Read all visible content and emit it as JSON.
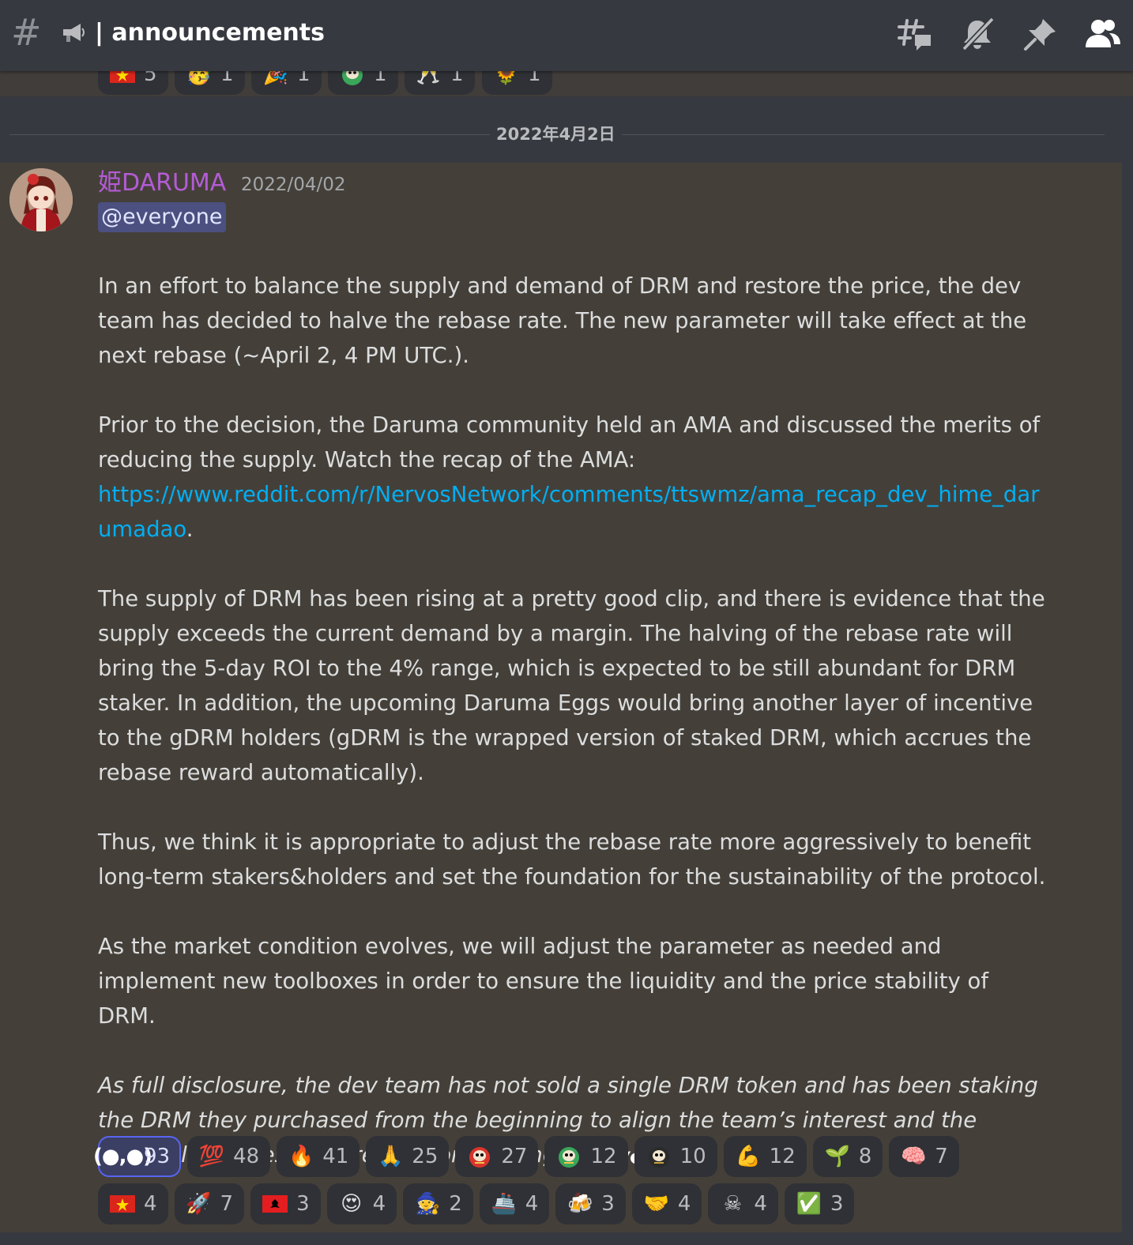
{
  "header": {
    "hash_symbol": "#",
    "channel_name": "| announcements",
    "icons": [
      "threads-icon",
      "mute-icon",
      "pin-icon",
      "members-icon"
    ]
  },
  "previous_reactions": [
    {
      "emoji": "vietnam-flag",
      "count": "5"
    },
    {
      "emoji": "party-face",
      "count": "1"
    },
    {
      "emoji": "party-popper",
      "count": "1"
    },
    {
      "emoji": "green-daruma",
      "count": "1"
    },
    {
      "emoji": "clinking-glasses",
      "count": "1"
    },
    {
      "emoji": "sunflower",
      "count": "1"
    }
  ],
  "date_divider": "2022年4月2日",
  "message": {
    "author": "姫DARUMA",
    "timestamp": "2022/04/02",
    "mention": "@everyone",
    "paragraphs": [
      "In an effort to balance the supply and demand of DRM and restore the price, the dev team has decided to halve the rebase rate. The new parameter will take effect at the next rebase (~April 2, 4 PM UTC.).",
      "Prior to the decision, the Daruma community held an AMA and discussed the merits of reducing the supply. Watch the recap of the AMA:",
      "The supply of DRM has been rising at a pretty good clip, and there is evidence that the supply exceeds the current demand by a margin. The halving of the rebase rate will bring the 5-day ROI to the 4% range, which is expected to be still abundant for DRM staker. In addition, the upcoming Daruma Eggs would bring another layer of incentive to the gDRM holders (gDRM is the wrapped version of staked DRM, which accrues the rebase reward automatically).",
      "Thus, we think it is appropriate to adjust the rebase rate more aggressively to benefit long-term stakers&holders and set the foundation for the sustainability of the protocol.",
      "As the market condition evolves, we will adjust the parameter as needed and implement new toolboxes in order to ensure the liquidity and the price stability of DRM.",
      "As full disclosure, the dev team has not sold a single DRM token and has been staking the DRM they purchased from the beginning to align the team’s interest and the protocol’s success. We’re in it for the long haul."
    ],
    "link": "https://www.reddit.com/r/NervosNetwork/comments/ttswmz/ama_recap_dev_hime_darumadao",
    "link_suffix": ".",
    "trailing_emoji": "(●,●)"
  },
  "reactions_row1": [
    {
      "emoji": "(●,●)",
      "name": "daruma-face-emoji",
      "count": "93",
      "active": true
    },
    {
      "emoji": "💯",
      "name": "hundred-points-emoji",
      "count": "48"
    },
    {
      "emoji": "🔥",
      "name": "fire-emoji",
      "count": "41"
    },
    {
      "emoji": "🙏",
      "name": "pray-emoji",
      "count": "25"
    },
    {
      "emoji": "red-daruma",
      "name": "red-daruma-emoji",
      "count": "27"
    },
    {
      "emoji": "green-daruma",
      "name": "green-daruma-emoji",
      "count": "12"
    },
    {
      "emoji": "black-daruma",
      "name": "black-daruma-emoji",
      "count": "10"
    },
    {
      "emoji": "💪",
      "name": "flexed-biceps-emoji",
      "count": "12"
    },
    {
      "emoji": "🌱",
      "name": "seedling-emoji",
      "count": "8"
    },
    {
      "emoji": "🧠",
      "name": "brain-emoji",
      "count": "7"
    }
  ],
  "reactions_row2": [
    {
      "emoji": "vietnam-flag",
      "name": "vietnam-flag-emoji",
      "count": "4"
    },
    {
      "emoji": "🚀",
      "name": "rocket-emoji",
      "count": "7"
    },
    {
      "emoji": "albania-flag",
      "name": "albania-flag-emoji",
      "count": "3"
    },
    {
      "emoji": "😍",
      "name": "heart-eyes-emoji",
      "count": "4"
    },
    {
      "emoji": "🧙",
      "name": "mage-emoji",
      "count": "2"
    },
    {
      "emoji": "🚢",
      "name": "ship-emoji",
      "count": "4"
    },
    {
      "emoji": "🍻",
      "name": "beers-emoji",
      "count": "3"
    },
    {
      "emoji": "🤝",
      "name": "handshake-emoji",
      "count": "4"
    },
    {
      "emoji": "☠",
      "name": "skull-crossbones-emoji",
      "count": "4"
    },
    {
      "emoji": "✅",
      "name": "check-mark-emoji",
      "count": "3"
    }
  ],
  "colors": {
    "background": "#36393f",
    "highlight": "#444039",
    "author": "#b45bd6",
    "link": "#00aff4",
    "mention_bg": "#4b5080",
    "active_reaction_border": "#5865f2"
  }
}
